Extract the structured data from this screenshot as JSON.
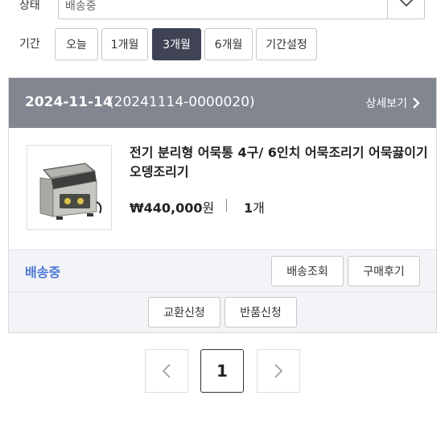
{
  "filters": {
    "status_label": "상태",
    "status_value": "배송중",
    "period_label": "기간",
    "period_options": [
      "오늘",
      "1개월",
      "3개월",
      "6개월",
      "기간설정"
    ],
    "period_selected": "3개월"
  },
  "order": {
    "date": "2024-11-14",
    "order_number": "(20241114-0000020)",
    "detail_link": "상세보기",
    "product_name": "전기 분리형 어묵통 4구/ 6인치 어묵조리기 어묵끓이기 오뎅조리기",
    "price_amount": "₩440,000",
    "price_unit": "원",
    "quantity_number": "1",
    "quantity_unit": "개",
    "delivery_status": "배송중",
    "buttons": {
      "track": "배송조회",
      "review": "구매후기",
      "exchange": "교환신청",
      "return": "반품신청"
    }
  },
  "pagination": {
    "current_page": "1"
  },
  "colors": {
    "header_bg": "#828690",
    "active_period_bg": "#3f4354",
    "status_text": "#4b78d4",
    "footer_bg": "#f3f4f8"
  },
  "icons": [
    "chevron-down-icon",
    "chevron-right-icon",
    "prev-page-icon",
    "next-page-icon"
  ]
}
